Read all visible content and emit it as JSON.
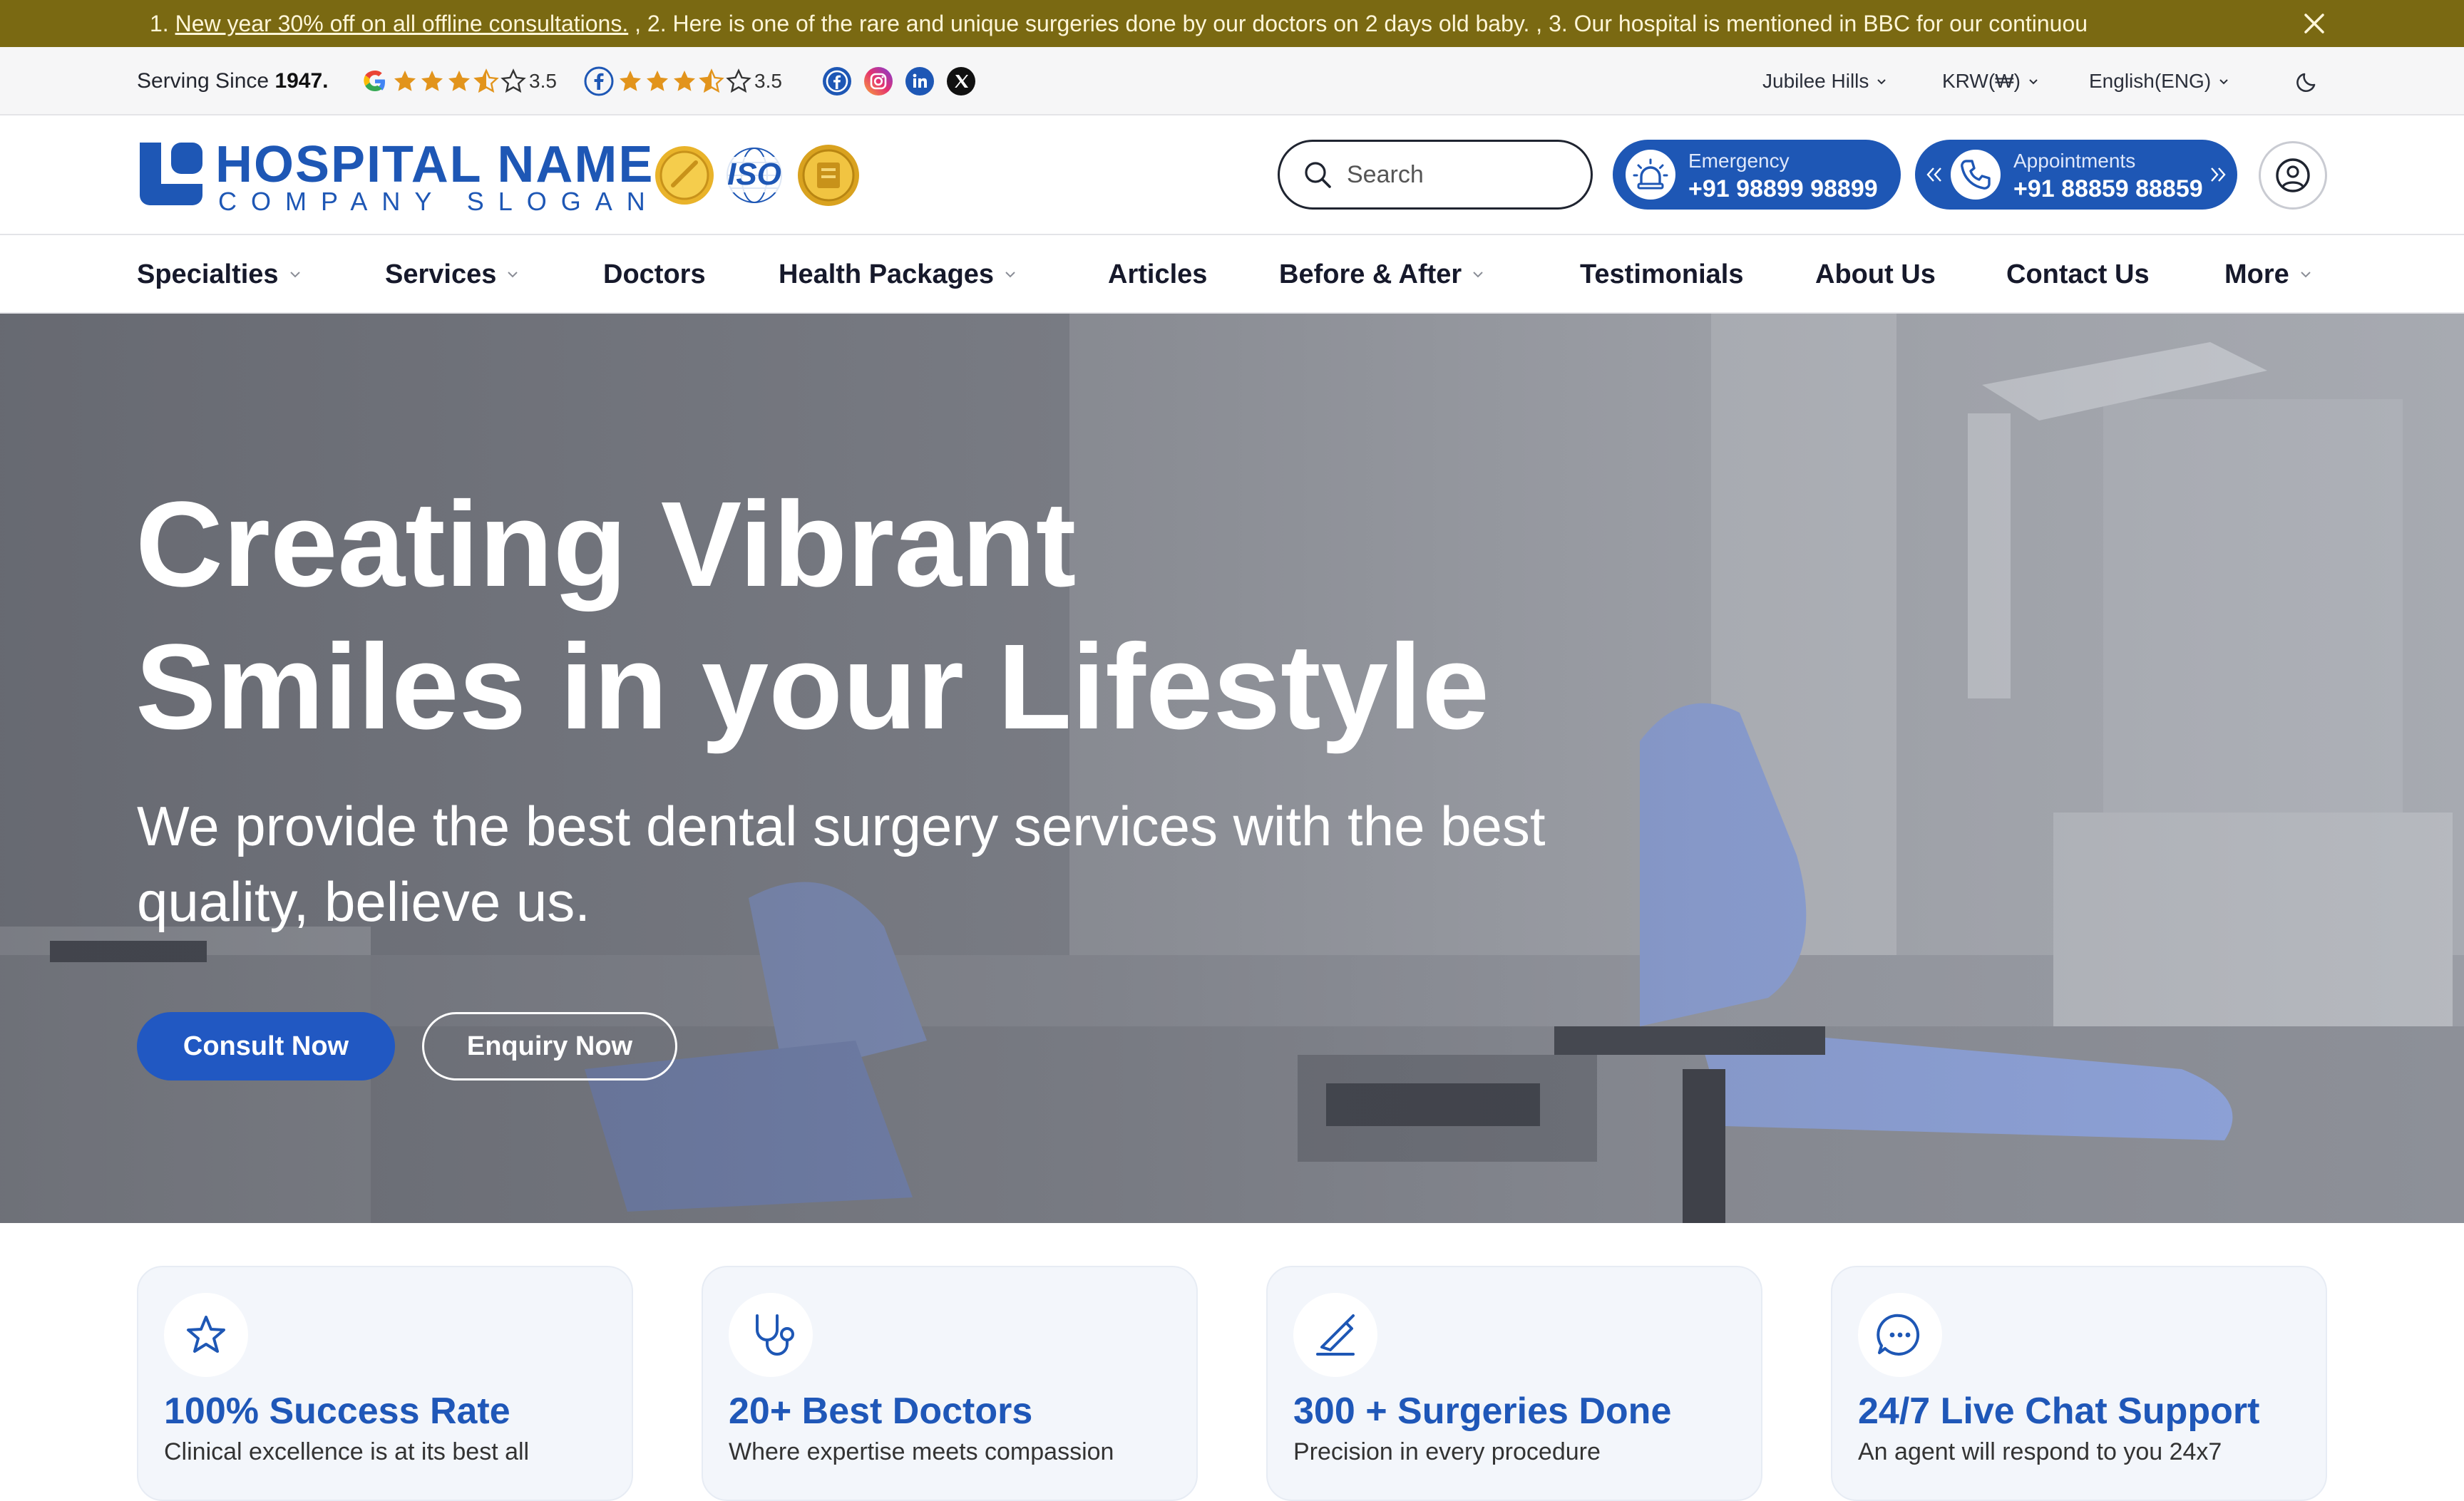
{
  "announcement": {
    "prefix": "1. ",
    "link_text": "New year 30% off on all offline consultations.",
    "rest": " , 2. Here is one of the rare and unique surgeries done by our doctors on 2 days old baby. , 3. Our hospital is mentioned in BBC for our continuou"
  },
  "utility": {
    "serving_prefix": "Serving Since ",
    "serving_year": "1947.",
    "google_rating": "3.5",
    "facebook_rating": "3.5",
    "location": "Jubilee Hills",
    "currency": "KRW(₩)",
    "language": "English(ENG)"
  },
  "header": {
    "brand_name": "HOSPITAL NAME",
    "brand_slogan": "COMPANY SLOGAN",
    "accreditation_badge_text": "ISO",
    "search_placeholder": "Search",
    "emergency_label": "Emergency",
    "emergency_number": "+91 98899 98899",
    "appointments_label": "Appointments",
    "appointments_number": "+91 88859 88859"
  },
  "nav": {
    "items": [
      {
        "label": "Specialties",
        "has_dropdown": true
      },
      {
        "label": "Services",
        "has_dropdown": true
      },
      {
        "label": "Doctors",
        "has_dropdown": false
      },
      {
        "label": "Health Packages",
        "has_dropdown": true
      },
      {
        "label": "Articles",
        "has_dropdown": false
      },
      {
        "label": "Before & After",
        "has_dropdown": true
      },
      {
        "label": "Testimonials",
        "has_dropdown": false
      },
      {
        "label": "About Us",
        "has_dropdown": false
      },
      {
        "label": "Contact Us",
        "has_dropdown": false
      },
      {
        "label": "More",
        "has_dropdown": true
      }
    ]
  },
  "hero": {
    "title_line1": "Creating Vibrant",
    "title_line2": "Smiles in your Lifestyle",
    "subtitle": "We provide the best dental surgery services with the best quality, believe us.",
    "primary_button": "Consult Now",
    "secondary_button": "Enquiry Now"
  },
  "features": [
    {
      "icon": "star-icon",
      "title": "100% Success Rate",
      "desc": "Clinical excellence is at its best all"
    },
    {
      "icon": "stethoscope-icon",
      "title": "20+ Best Doctors",
      "desc": "Where expertise meets compassion"
    },
    {
      "icon": "scalpel-icon",
      "title": "300 + Surgeries Done",
      "desc": "Precision in every procedure"
    },
    {
      "icon": "chat-icon",
      "title": "24/7 Live Chat Support",
      "desc": "An agent will respond to you 24x7"
    }
  ],
  "colors": {
    "brand_blue": "#1e57b5",
    "announcement_bg": "#7a6912",
    "star": "#e2941c"
  }
}
